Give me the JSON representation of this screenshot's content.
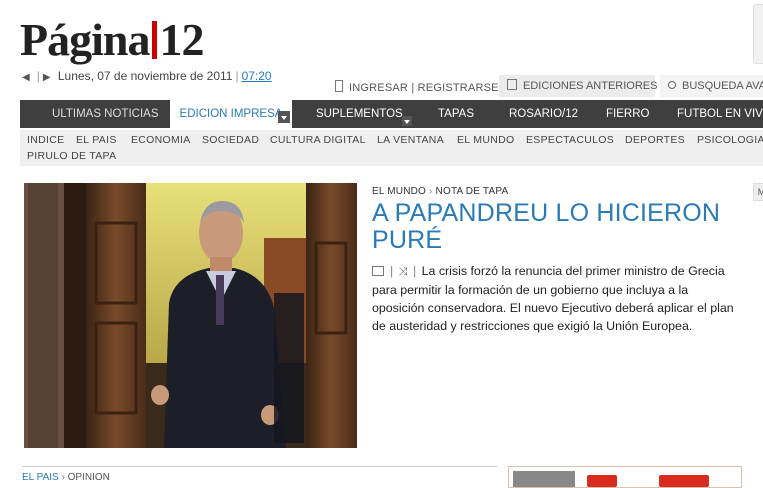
{
  "logo": {
    "text": "Página",
    "number": "12"
  },
  "date_bar": {
    "date": "Lunes, 07 de noviembre de 2011",
    "time": "07:20"
  },
  "user_links": {
    "login": "INGRESAR",
    "register": "REGISTRARSE"
  },
  "tabs": {
    "editions": "EDICIONES ANTERIORES",
    "search": "BUSQUEDA AVA"
  },
  "main_nav": {
    "items": [
      "ULTIMAS NOTICIAS",
      "EDICION IMPRESA",
      "SUPLEMENTOS",
      "TAPAS",
      "ROSARIO/12",
      "FIERRO",
      "FUTBOL EN VIVO"
    ]
  },
  "sub_nav": {
    "items": [
      "INDICE",
      "EL PAIS",
      "ECONOMIA",
      "SOCIEDAD",
      "CULTURA DIGITAL",
      "LA VENTANA",
      "EL MUNDO",
      "ESPECTACULOS",
      "DEPORTES",
      "PSICOLOGIA",
      "PIRULO DE TAPA"
    ]
  },
  "article": {
    "section": "EL MUNDO",
    "subsection": "NOTA DE TAPA",
    "headline": "A PAPANDREU LO HICIERON PURÉ",
    "summary": "La crisis forzó la renuncia del primer ministro de Grecia para permitir la formación de un gobierno que incluya a la oposición conservadora. El nuevo Ejecutivo deberá aplicar el plan de austeridad y restricciones que exigió la Unión Europea."
  },
  "right_tab": "M",
  "bottom": {
    "section": "EL PAIS",
    "subsection": "OPINION"
  },
  "colors": {
    "accent": "#2a7ab8",
    "nav_bg": "#3f3f3f",
    "subnav_bg": "#efefef",
    "logo_red": "#cc0000"
  }
}
